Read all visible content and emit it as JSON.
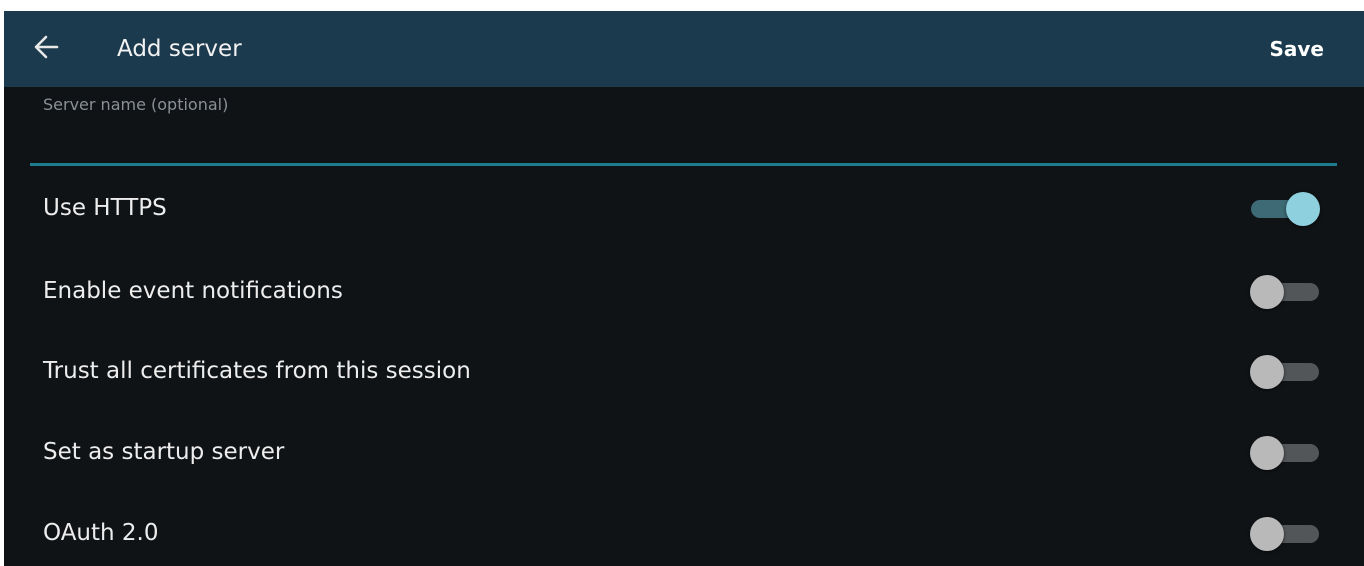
{
  "appbar": {
    "title": "Add server",
    "save_label": "Save",
    "back_icon": "arrow-back-icon",
    "background_color": "#1c3a4d"
  },
  "server_name_field": {
    "label": "Server name (optional)",
    "value": "",
    "underline_color": "#1f7c8e"
  },
  "settings": [
    {
      "label": "Use HTTPS",
      "enabled": true
    },
    {
      "label": "Enable event notifications",
      "enabled": false
    },
    {
      "label": "Trust all certificates from this session",
      "enabled": false
    },
    {
      "label": "Set as startup server",
      "enabled": false
    },
    {
      "label": "OAuth 2.0",
      "enabled": false
    }
  ],
  "colors": {
    "switch_on_thumb": "#8fd0de",
    "switch_off_thumb": "#b9b9b9"
  }
}
